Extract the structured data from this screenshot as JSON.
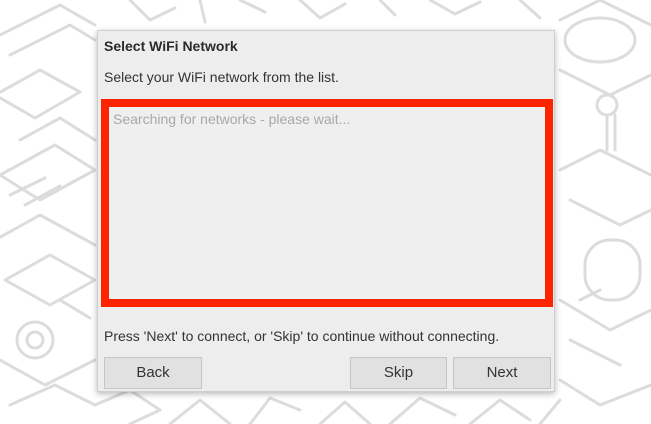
{
  "dialog": {
    "title": "Select WiFi Network",
    "instruction": "Select your WiFi network from the list.",
    "network_list": {
      "placeholder": "Searching for networks - please wait...",
      "highlight_color": "#ff2400"
    },
    "help_text": "Press 'Next' to connect, or 'Skip' to continue without connecting.",
    "buttons": {
      "back": "Back",
      "skip": "Skip",
      "next": "Next"
    }
  }
}
